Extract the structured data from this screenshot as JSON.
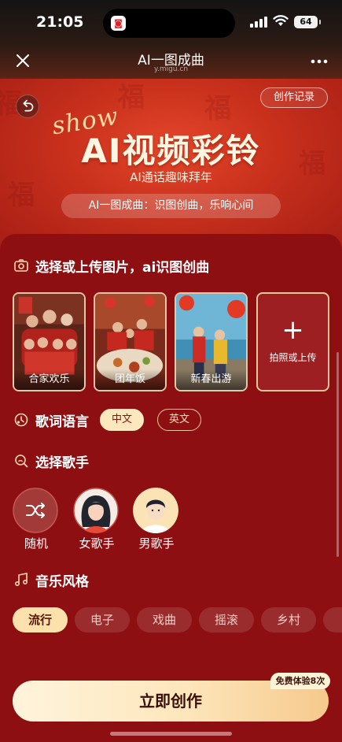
{
  "status_bar": {
    "time": "21:05",
    "battery": "64",
    "icons": [
      "signal-icon",
      "wifi-icon",
      "battery-icon"
    ]
  },
  "nav": {
    "title": "AI一图成曲",
    "subtitle": "y.migu.cn",
    "close_icon": "close-icon",
    "more_icon": "more-icon"
  },
  "banner": {
    "show_word": "show",
    "title": "AI视频彩铃",
    "subtitle": "AI通话趣味拜年",
    "pill": "AI一图成曲：识图创曲，乐响心间",
    "record_button": "创作记录"
  },
  "upload_section": {
    "title": "选择或上传图片，ai识图创曲",
    "icon": "camera-icon",
    "cards": [
      {
        "label": "合家欢乐"
      },
      {
        "label": "团年饭"
      },
      {
        "label": "新春出游"
      }
    ],
    "upload_card": {
      "label": "拍照或上传",
      "icon": "plus-icon"
    }
  },
  "lyrics_language": {
    "title": "歌词语言",
    "icon": "language-icon",
    "options": [
      "中文",
      "英文"
    ],
    "selected": "中文"
  },
  "singer_section": {
    "title": "选择歌手",
    "icon": "search-person-icon",
    "singers": [
      {
        "label": "随机",
        "icon": "shuffle-icon"
      },
      {
        "label": "女歌手"
      },
      {
        "label": "男歌手"
      }
    ],
    "selected": "男歌手"
  },
  "music_style": {
    "title": "音乐风格",
    "icon": "music-note-icon",
    "options": [
      "流行",
      "电子",
      "戏曲",
      "摇滚",
      "乡村"
    ],
    "selected": "流行"
  },
  "cta": {
    "label": "立即创作",
    "badge": "免费体验8次"
  },
  "colors": {
    "panel_bg": "#8e0f12",
    "accent_gold": "#fde1ad",
    "banner_red": "#c8301c"
  }
}
